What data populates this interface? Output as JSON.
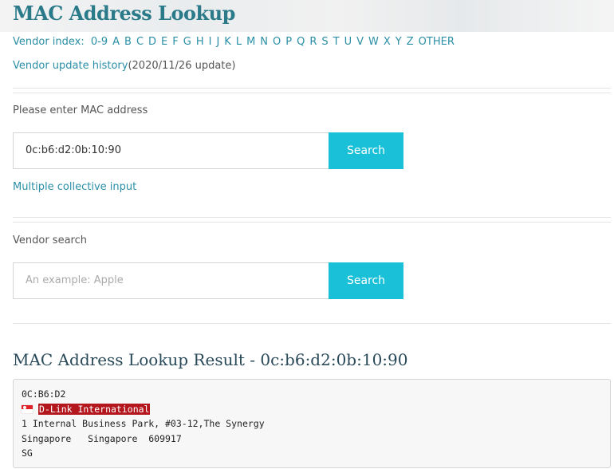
{
  "page": {
    "title": "MAC Address Lookup"
  },
  "vendor_index": {
    "label": "Vendor index:",
    "letters": [
      "0-9",
      "A",
      "B",
      "C",
      "D",
      "E",
      "F",
      "G",
      "H",
      "I",
      "J",
      "K",
      "L",
      "M",
      "N",
      "O",
      "P",
      "Q",
      "R",
      "S",
      "T",
      "U",
      "V",
      "W",
      "X",
      "Y",
      "Z",
      "OTHER"
    ]
  },
  "update": {
    "link_text": "Vendor update history",
    "date_text": "(2020/11/26 update)"
  },
  "mac_search": {
    "label": "Please enter MAC address",
    "value": "0c:b6:d2:0b:10:90",
    "button": "Search",
    "multi_link": "Multiple collective input"
  },
  "vendor_search": {
    "label": "Vendor search",
    "placeholder": "An example: Apple",
    "button": "Search"
  },
  "result": {
    "title": "MAC Address Lookup Result - 0c:b6:d2:0b:10:90",
    "oui": "0C:B6:D2",
    "flag_icon": "singapore-flag",
    "vendor": "D-Link International",
    "address_line1": "1 Internal Business Park, #03-12,The Synergy",
    "address_line2": "Singapore   Singapore  609917",
    "country_code": "SG"
  },
  "colors": {
    "accent": "#19c0d8",
    "link": "#2a8fa6",
    "vendor_highlight": "#b3161d"
  }
}
